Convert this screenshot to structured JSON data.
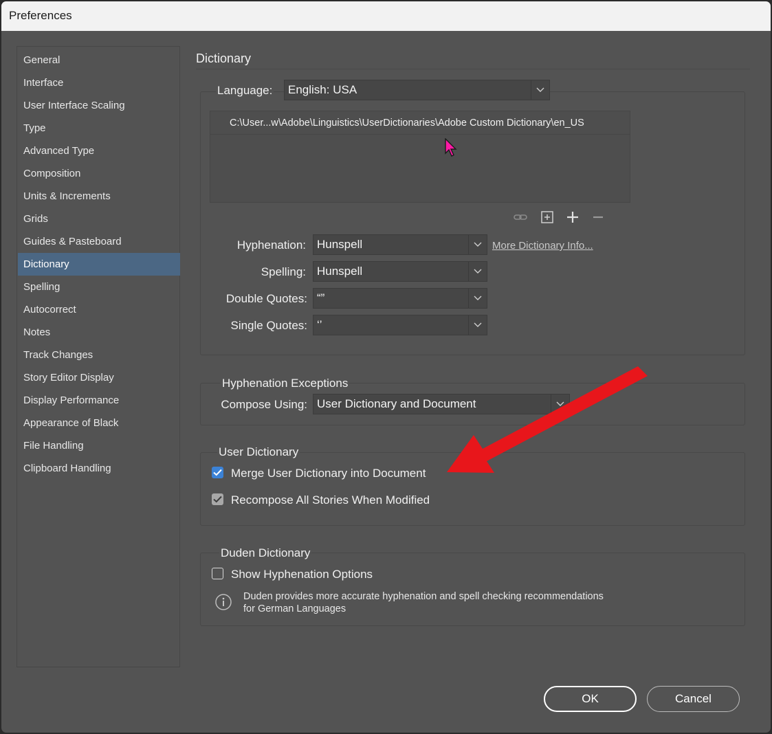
{
  "window": {
    "title": "Preferences"
  },
  "sidebar": {
    "items": [
      {
        "label": "General"
      },
      {
        "label": "Interface"
      },
      {
        "label": "User Interface Scaling"
      },
      {
        "label": "Type"
      },
      {
        "label": "Advanced Type"
      },
      {
        "label": "Composition"
      },
      {
        "label": "Units & Increments"
      },
      {
        "label": "Grids"
      },
      {
        "label": "Guides & Pasteboard"
      },
      {
        "label": "Dictionary",
        "selected": true
      },
      {
        "label": "Spelling"
      },
      {
        "label": "Autocorrect"
      },
      {
        "label": "Notes"
      },
      {
        "label": "Track Changes"
      },
      {
        "label": "Story Editor Display"
      },
      {
        "label": "Display Performance"
      },
      {
        "label": "Appearance of Black"
      },
      {
        "label": "File Handling"
      },
      {
        "label": "Clipboard Handling"
      }
    ]
  },
  "main": {
    "title": "Dictionary",
    "language": {
      "label": "Language:",
      "value": "English: USA"
    },
    "dictionary_list": [
      "C:\\User...w\\Adobe\\Linguistics\\UserDictionaries\\Adobe Custom Dictionary\\en_US"
    ],
    "list_tools": [
      "link-icon",
      "new-dictionary-icon",
      "add-icon",
      "remove-icon"
    ],
    "hyphenation": {
      "label": "Hyphenation:",
      "value": "Hunspell"
    },
    "more_info_link": "More Dictionary Info...",
    "spelling": {
      "label": "Spelling:",
      "value": "Hunspell"
    },
    "double_quotes": {
      "label": "Double Quotes:",
      "value": "“”"
    },
    "single_quotes": {
      "label": "Single Quotes:",
      "value": "‘’"
    },
    "hyphenation_exceptions": {
      "title": "Hyphenation Exceptions",
      "compose_label": "Compose Using:",
      "compose_value": "User Dictionary and Document"
    },
    "user_dictionary": {
      "title": "User Dictionary",
      "merge": {
        "label": "Merge User Dictionary into Document",
        "checked": true
      },
      "recompose": {
        "label": "Recompose All Stories When Modified",
        "checked": true
      }
    },
    "duden": {
      "title": "Duden Dictionary",
      "show_options": {
        "label": "Show Hyphenation Options",
        "checked": false
      },
      "info_line1": "Duden provides more accurate hyphenation and spell checking recommendations",
      "info_line2": "for German Languages"
    }
  },
  "footer": {
    "ok_label": "OK",
    "cancel_label": "Cancel"
  },
  "colors": {
    "selection": "#4b6784",
    "checkbox_accent": "#3b82d6",
    "annotation_arrow": "#e8161b"
  }
}
